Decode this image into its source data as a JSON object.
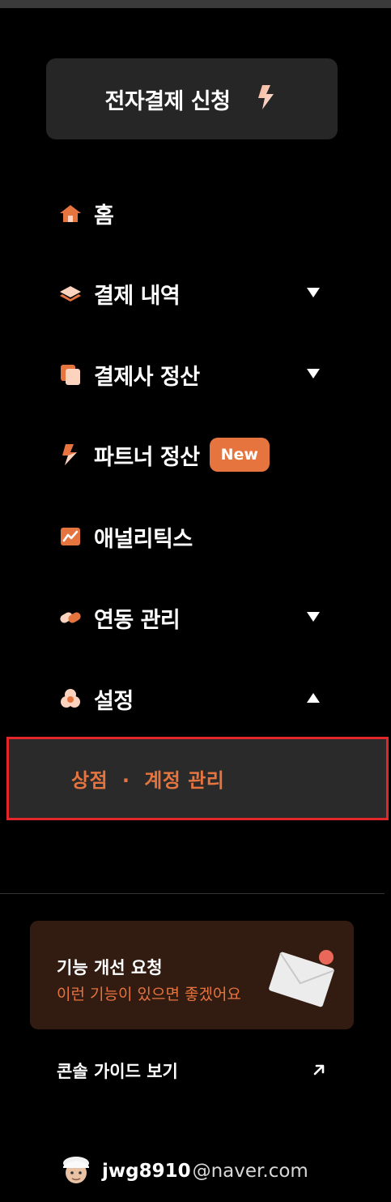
{
  "apply_button": {
    "label": "전자결제 신청",
    "icon": "lightning-icon"
  },
  "nav": [
    {
      "label": "홈",
      "icon": "home-icon",
      "caret": "none"
    },
    {
      "label": "결제 내역",
      "icon": "layers-icon",
      "caret": "down"
    },
    {
      "label": "결제사 정산",
      "icon": "copy-icon",
      "caret": "down"
    },
    {
      "label": "파트너 정산",
      "icon": "bolt-icon",
      "caret": "none",
      "badge": "New"
    },
    {
      "label": "애널리틱스",
      "icon": "chart-icon",
      "caret": "none"
    },
    {
      "label": "연동 관리",
      "icon": "link-icon",
      "caret": "down"
    },
    {
      "label": "설정",
      "icon": "settings-icon",
      "caret": "up"
    }
  ],
  "settings_sub": {
    "label": "상점  ·  계정 관리",
    "selected": true
  },
  "feedback": {
    "title": "기능 개선 요청",
    "subtitle": "이런 기능이 있으면 좋겠어요",
    "icon": "envelope-icon"
  },
  "guide": {
    "label": "콘솔 가이드 보기",
    "icon": "external-arrow-icon"
  },
  "user": {
    "username": "jwg8910",
    "domain": "@naver.com"
  },
  "colors": {
    "accent": "#e6743f",
    "background": "#000000",
    "button": "#262626",
    "selection_border": "#e2262a",
    "feedback_bg": "#321b10"
  }
}
